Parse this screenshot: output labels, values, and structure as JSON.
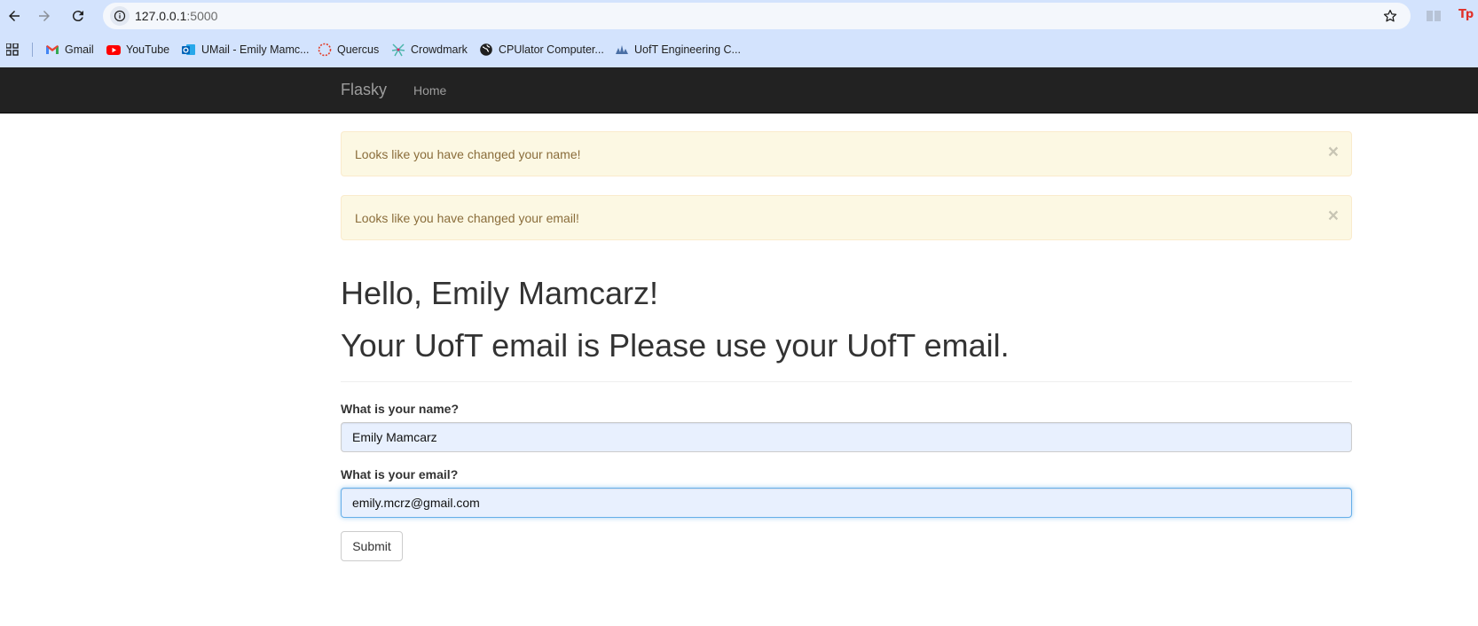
{
  "browser": {
    "url_host": "127.0.0.1",
    "url_port": ":5000",
    "bookmarks": [
      {
        "label": "Gmail",
        "icon": "gmail-icon"
      },
      {
        "label": "YouTube",
        "icon": "youtube-icon"
      },
      {
        "label": "UMail - Emily Mamc...",
        "icon": "outlook-icon"
      },
      {
        "label": "Quercus",
        "icon": "quercus-icon"
      },
      {
        "label": "Crowdmark",
        "icon": "crowdmark-icon"
      },
      {
        "label": "CPUlator Computer...",
        "icon": "globe-icon"
      },
      {
        "label": "UofT Engineering C...",
        "icon": "uoft-icon"
      }
    ],
    "extension_tp": "Tp"
  },
  "navbar": {
    "brand": "Flasky",
    "links": [
      "Home"
    ]
  },
  "alerts": [
    {
      "message": "Looks like you have changed your name!",
      "close": "×"
    },
    {
      "message": "Looks like you have changed your email!",
      "close": "×"
    }
  ],
  "main": {
    "greeting": "Hello, Emily Mamcarz!",
    "email_line": "Your UofT email is Please use your UofT email."
  },
  "form": {
    "name_label": "What is your name?",
    "name_value": "Emily Mamcarz",
    "email_label": "What is your email?",
    "email_value": "emily.mcrz@gmail.com",
    "submit_label": "Submit"
  },
  "colors": {
    "chrome_bg": "#d3e3fd",
    "navbar_bg": "#222222",
    "alert_bg": "#fcf8e3",
    "alert_text": "#8a6d3b",
    "autofill_bg": "#e8f0fe"
  }
}
